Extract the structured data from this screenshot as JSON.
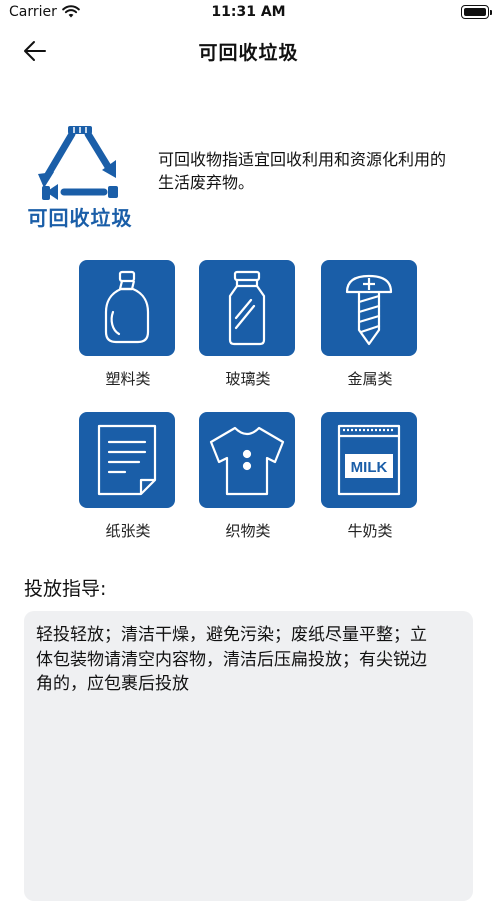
{
  "status_bar": {
    "carrier": "Carrier",
    "time": "11:31 AM"
  },
  "nav": {
    "title": "可回收垃圾"
  },
  "header": {
    "logo_label": "可回收垃圾",
    "description": "可回收物指适宜回收利用和资源化利用的生活废弃物。"
  },
  "categories": [
    {
      "label": "塑料类",
      "icon": "plastic-bottle-icon"
    },
    {
      "label": "玻璃类",
      "icon": "glass-bottle-icon"
    },
    {
      "label": "金属类",
      "icon": "screw-icon"
    },
    {
      "label": "纸张类",
      "icon": "paper-icon"
    },
    {
      "label": "织物类",
      "icon": "shirt-icon"
    },
    {
      "label": "牛奶类",
      "icon": "milk-carton-icon",
      "icon_text": "MILK"
    }
  ],
  "guidance": {
    "title": "投放指导:",
    "text": "轻投轻放；清洁干燥，避免污染；废纸尽量平整；立体包装物请清空内容物，清洁后压扁投放；有尖锐边角的，应包裹后投放"
  },
  "colors": {
    "brand_blue": "#1a5ea8",
    "guide_bg": "#eff0f2"
  }
}
